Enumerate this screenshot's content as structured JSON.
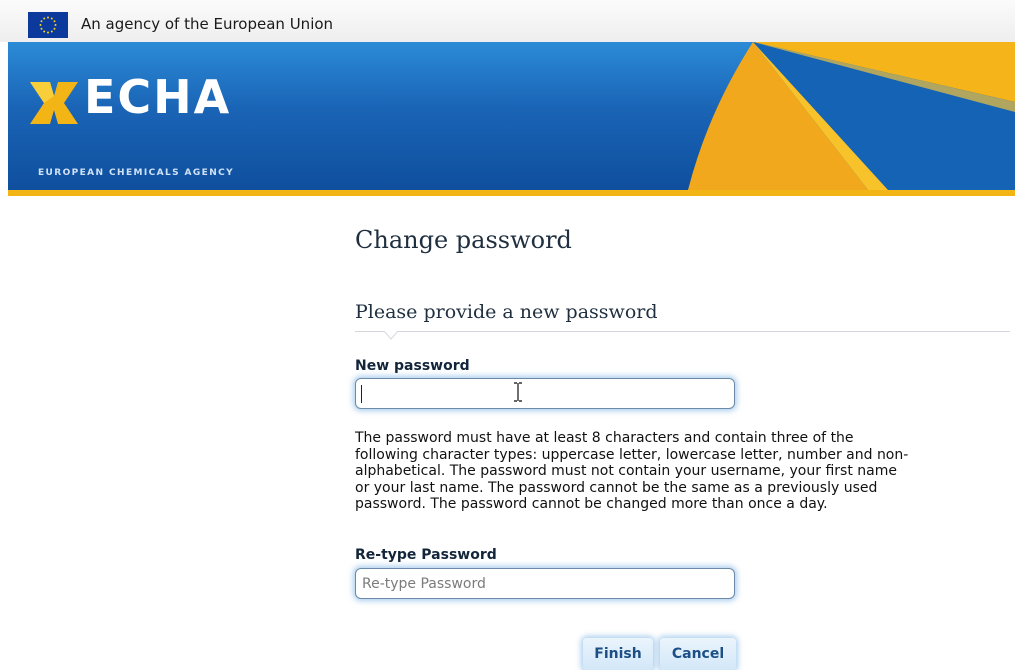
{
  "eu_strip": {
    "text": "An agency of the European Union",
    "flag_icon": "eu-flag-icon"
  },
  "header": {
    "logo_word": "ECHA",
    "logo_subtitle": "EUROPEAN CHEMICALS AGENCY",
    "logo_icon": "echa-logo-mark-icon",
    "colors": {
      "banner_blue": "#1a64b6",
      "accent_gold": "#f3b515"
    }
  },
  "main": {
    "title": "Change password",
    "section_title": "Please provide a new password",
    "new_password": {
      "label": "New password",
      "value": "",
      "placeholder": ""
    },
    "help_text_lines": [
      "The password must have at least 8 characters and contain three of the",
      "following character types: uppercase letter, lowercase letter, number and non-",
      "alphabetical. The password must not contain your username, your first name",
      "or your last name. The password cannot be the same as a previously used",
      "password. The password cannot be changed more than once a day."
    ],
    "retype_password": {
      "label": "Re-type Password",
      "value": "",
      "placeholder": "Re-type Password"
    },
    "buttons": {
      "finish": "Finish",
      "cancel": "Cancel"
    }
  }
}
